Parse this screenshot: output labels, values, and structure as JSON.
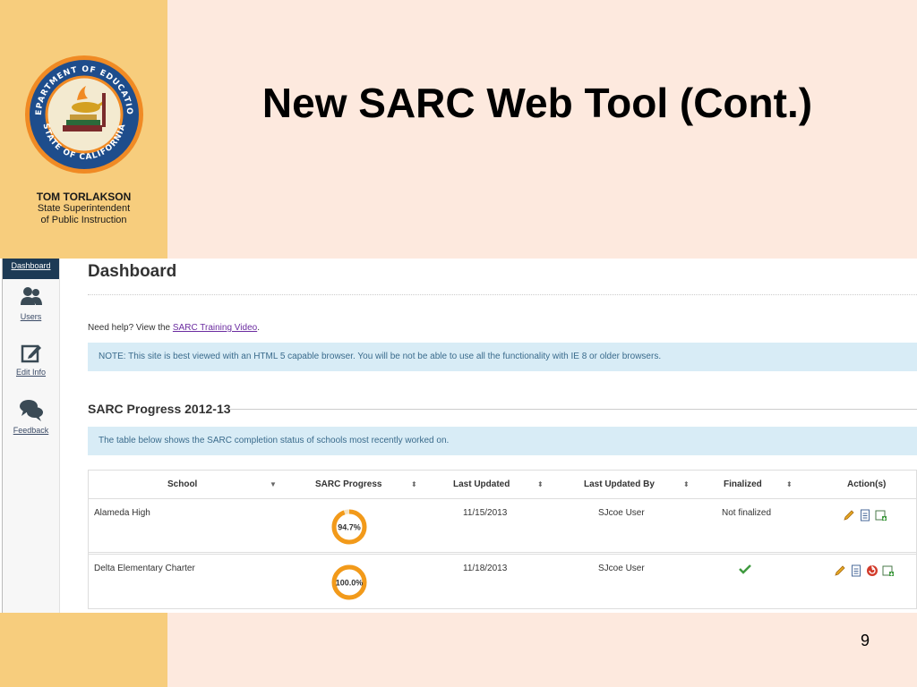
{
  "slide": {
    "title": "New SARC Web Tool (Cont.)",
    "page_number": "9",
    "superintendent": {
      "name": "TOM TORLAKSON",
      "role_line1": "State Superintendent",
      "role_line2": "of Public Instruction"
    },
    "seal": {
      "top_text": "DEPARTMENT OF EDUCATION",
      "bottom_text": "STATE OF CALIFORNIA"
    },
    "colors": {
      "background": "#fde9de",
      "left_band": "#f7cd7d"
    }
  },
  "app": {
    "sidebar": {
      "items": [
        {
          "label": "Dashboard",
          "icon": "dashboard"
        },
        {
          "label": "Users",
          "icon": "users-icon"
        },
        {
          "label": "Edit Info",
          "icon": "edit-icon"
        },
        {
          "label": "Feedback",
          "icon": "chat-bubbles-icon"
        }
      ]
    },
    "main": {
      "title": "Dashboard",
      "help_prefix": "Need help? View the ",
      "help_link": "SARC Training Video",
      "help_suffix": ".",
      "browser_note": "NOTE: This site is best viewed with an HTML 5 capable browser. You will be not be able to use all the functionality with IE 8 or older browsers.",
      "progress_heading": "SARC Progress 2012-13",
      "table_note": "The table below shows the SARC completion status of schools most recently worked on.",
      "table": {
        "columns": [
          "School",
          "SARC Progress",
          "Last Updated",
          "Last Updated By",
          "Finalized",
          "Action(s)"
        ],
        "rows": [
          {
            "school": "Alameda High",
            "progress": 94.7,
            "progress_label": "94.7%",
            "last_updated": "11/15/2013",
            "last_updated_by": "SJcoe User",
            "finalized": "Not finalized",
            "actions": [
              "edit-icon",
              "document-icon",
              "export-icon"
            ]
          },
          {
            "school": "Delta Elementary Charter",
            "progress": 100.0,
            "progress_label": "100.0%",
            "last_updated": "11/18/2013",
            "last_updated_by": "SJcoe User",
            "finalized": "check-icon",
            "actions": [
              "edit-icon",
              "document-icon",
              "unfinalize-icon",
              "export-icon"
            ]
          }
        ]
      }
    }
  }
}
